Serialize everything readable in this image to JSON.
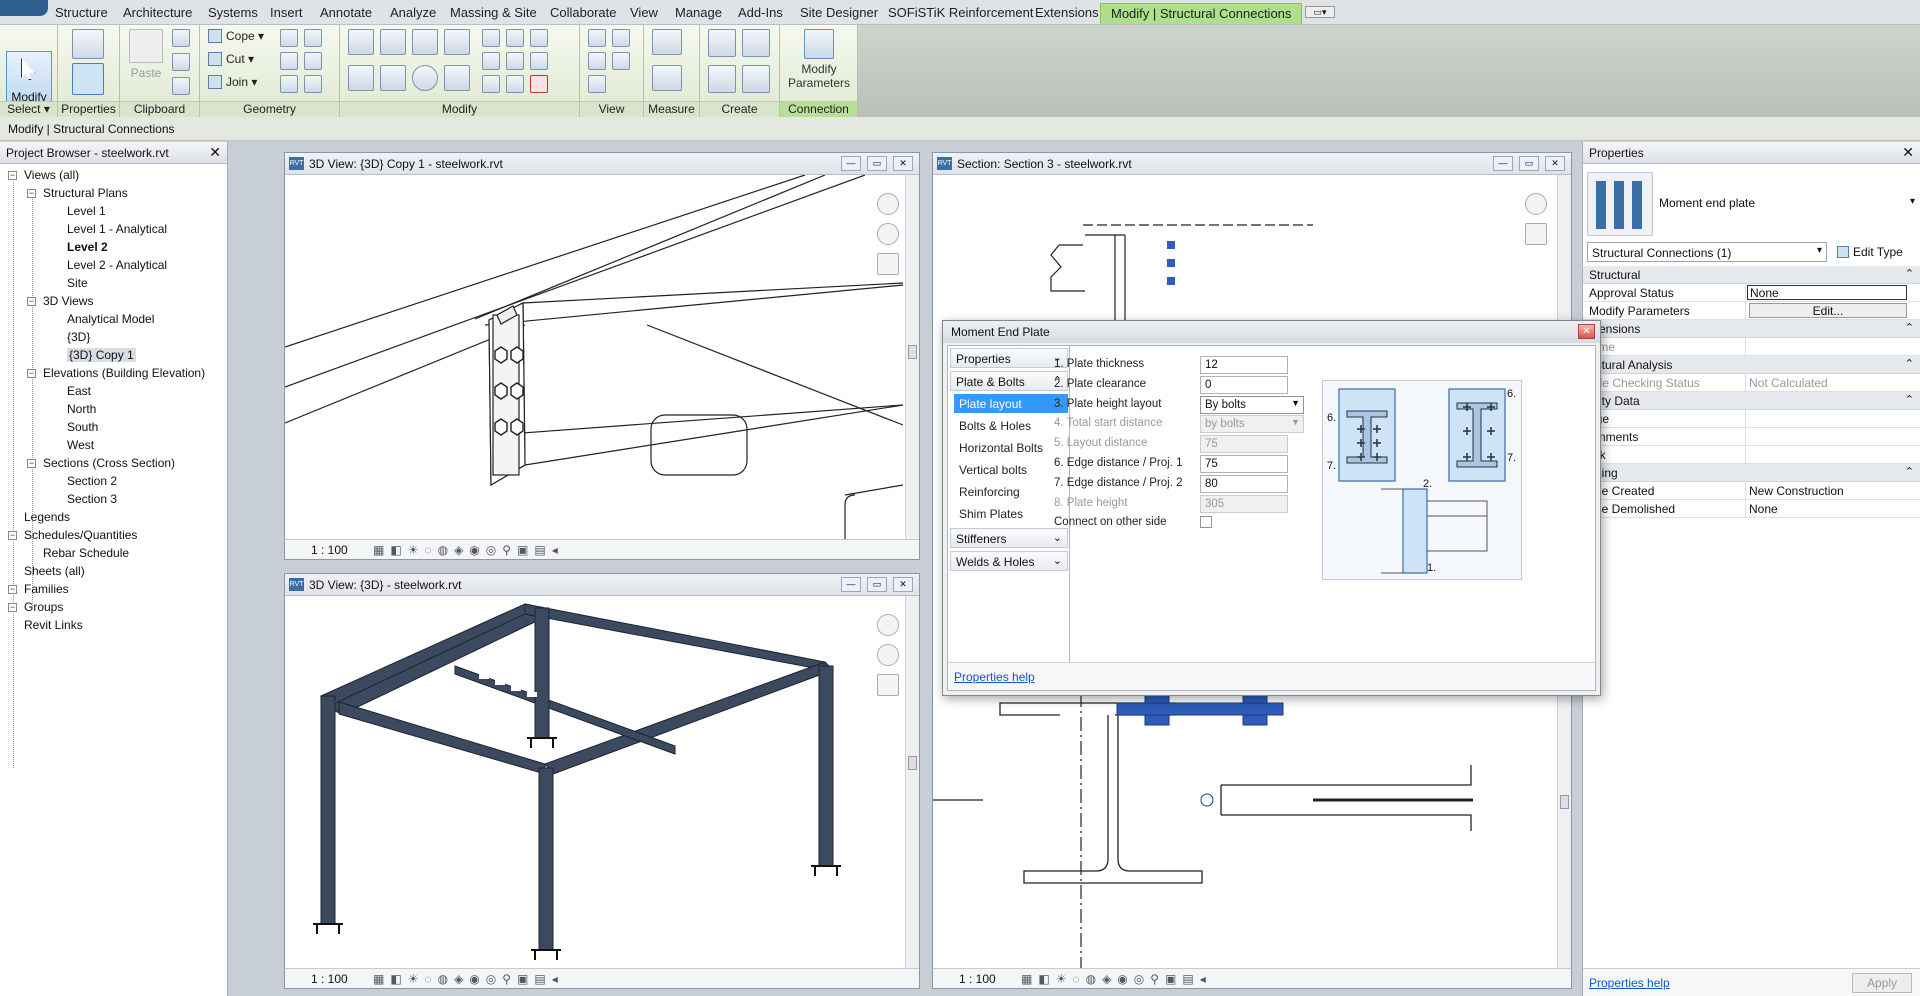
{
  "ribbon_tabs": [
    "Structure",
    "Architecture",
    "Systems",
    "Insert",
    "Annotate",
    "Analyze",
    "Massing & Site",
    "Collaborate",
    "View",
    "Manage",
    "Add-Ins",
    "Site Designer",
    "SOFiSTiK Reinforcement",
    "Extensions",
    "Modify | Structural Connections"
  ],
  "ribbon": {
    "modify_label": "Modify",
    "properties_label": "Properties",
    "paste_label": "Paste",
    "cope_label": "Cope",
    "cut_label": "Cut",
    "join_label": "Join",
    "modify_params_label1": "Modify",
    "modify_params_label2": "Parameters",
    "groups": [
      "Select",
      "Properties",
      "Clipboard",
      "Geometry",
      "Modify",
      "View",
      "Measure",
      "Create",
      "Connection"
    ]
  },
  "options_bar": "Modify | Structural Connections",
  "project_browser": {
    "title": "Project Browser - steelwork.rvt",
    "items": [
      "Views (all)",
      "Structural Plans",
      "Level 1",
      "Level 1 - Analytical",
      "Level 2",
      "Level 2 - Analytical",
      "Site",
      "3D Views",
      "Analytical Model",
      "{3D}",
      "{3D} Copy 1",
      "Elevations (Building Elevation)",
      "East",
      "North",
      "South",
      "West",
      "Sections (Cross Section)",
      "Section 2",
      "Section 3",
      "Legends",
      "Schedules/Quantities",
      "Rebar Schedule",
      "Sheets (all)",
      "Families",
      "Groups",
      "Revit Links"
    ]
  },
  "views": {
    "v1_title": "3D View: {3D} Copy 1 - steelwork.rvt",
    "v2_title": "3D View: {3D} - steelwork.rvt",
    "v3_title": "Section: Section 3 - steelwork.rvt",
    "scale": "1 : 100"
  },
  "properties": {
    "title": "Properties",
    "type_name": "Moment end plate",
    "selector": "Structural Connections (1)",
    "edit_type": "Edit Type",
    "rows": [
      {
        "kind": "cat",
        "label": "Structural"
      },
      {
        "kind": "row",
        "label": "Approval Status",
        "value": "None"
      },
      {
        "kind": "row",
        "label": "Modify Parameters",
        "value": "Edit..."
      },
      {
        "kind": "cat",
        "label": "mensions"
      },
      {
        "kind": "row",
        "label": "lume",
        "value": ""
      },
      {
        "kind": "cat",
        "label": "uctural Analysis"
      },
      {
        "kind": "row",
        "label": "ode Checking Status",
        "value": "Not Calculated"
      },
      {
        "kind": "cat",
        "label": "ntity Data"
      },
      {
        "kind": "row",
        "label": "age",
        "value": ""
      },
      {
        "kind": "row",
        "label": "omments",
        "value": ""
      },
      {
        "kind": "row",
        "label": "ark",
        "value": ""
      },
      {
        "kind": "cat",
        "label": "asing"
      },
      {
        "kind": "row",
        "label": "ase Created",
        "value": "New Construction"
      },
      {
        "kind": "row",
        "label": "ase Demolished",
        "value": "None"
      }
    ],
    "help": "Properties help",
    "apply": "Apply"
  },
  "dialog": {
    "title": "Moment End Plate",
    "nav": {
      "properties": "Properties",
      "plate_bolts": "Plate & Bolts",
      "sub": [
        "Plate layout",
        "Bolts & Holes",
        "Horizontal Bolts",
        "Vertical bolts",
        "Reinforcing",
        "Shim Plates"
      ],
      "stiffeners": "Stiffeners",
      "welds": "Welds & Holes"
    },
    "fields": [
      {
        "label": "1. Plate thickness",
        "value": "12",
        "type": "input",
        "disabled": false
      },
      {
        "label": "2. Plate clearance",
        "value": "0",
        "type": "input",
        "disabled": false
      },
      {
        "label": "3. Plate height layout",
        "value": "By bolts",
        "type": "select",
        "disabled": false
      },
      {
        "label": "4. Total start distance",
        "value": "by bolts",
        "type": "select",
        "disabled": true
      },
      {
        "label": "5. Layout distance",
        "value": "75",
        "type": "input",
        "disabled": true
      },
      {
        "label": "6. Edge distance / Proj. 1",
        "value": "75",
        "type": "input",
        "disabled": false
      },
      {
        "label": "7. Edge distance / Proj. 2",
        "value": "80",
        "type": "input",
        "disabled": false
      },
      {
        "label": "8. Plate height",
        "value": "305",
        "type": "input",
        "disabled": true
      },
      {
        "label": "Connect on other side",
        "value": "",
        "type": "checkbox",
        "disabled": false
      }
    ],
    "preview_labels": {
      "six": "6.",
      "seven": "7.",
      "two": "2.",
      "one": "1."
    },
    "help": "Properties help"
  },
  "colors": {
    "accent_tab": "#aee08a",
    "selection": "#3399ff",
    "steel": "#3b4a5e",
    "highlight": "#2e5cb8"
  }
}
